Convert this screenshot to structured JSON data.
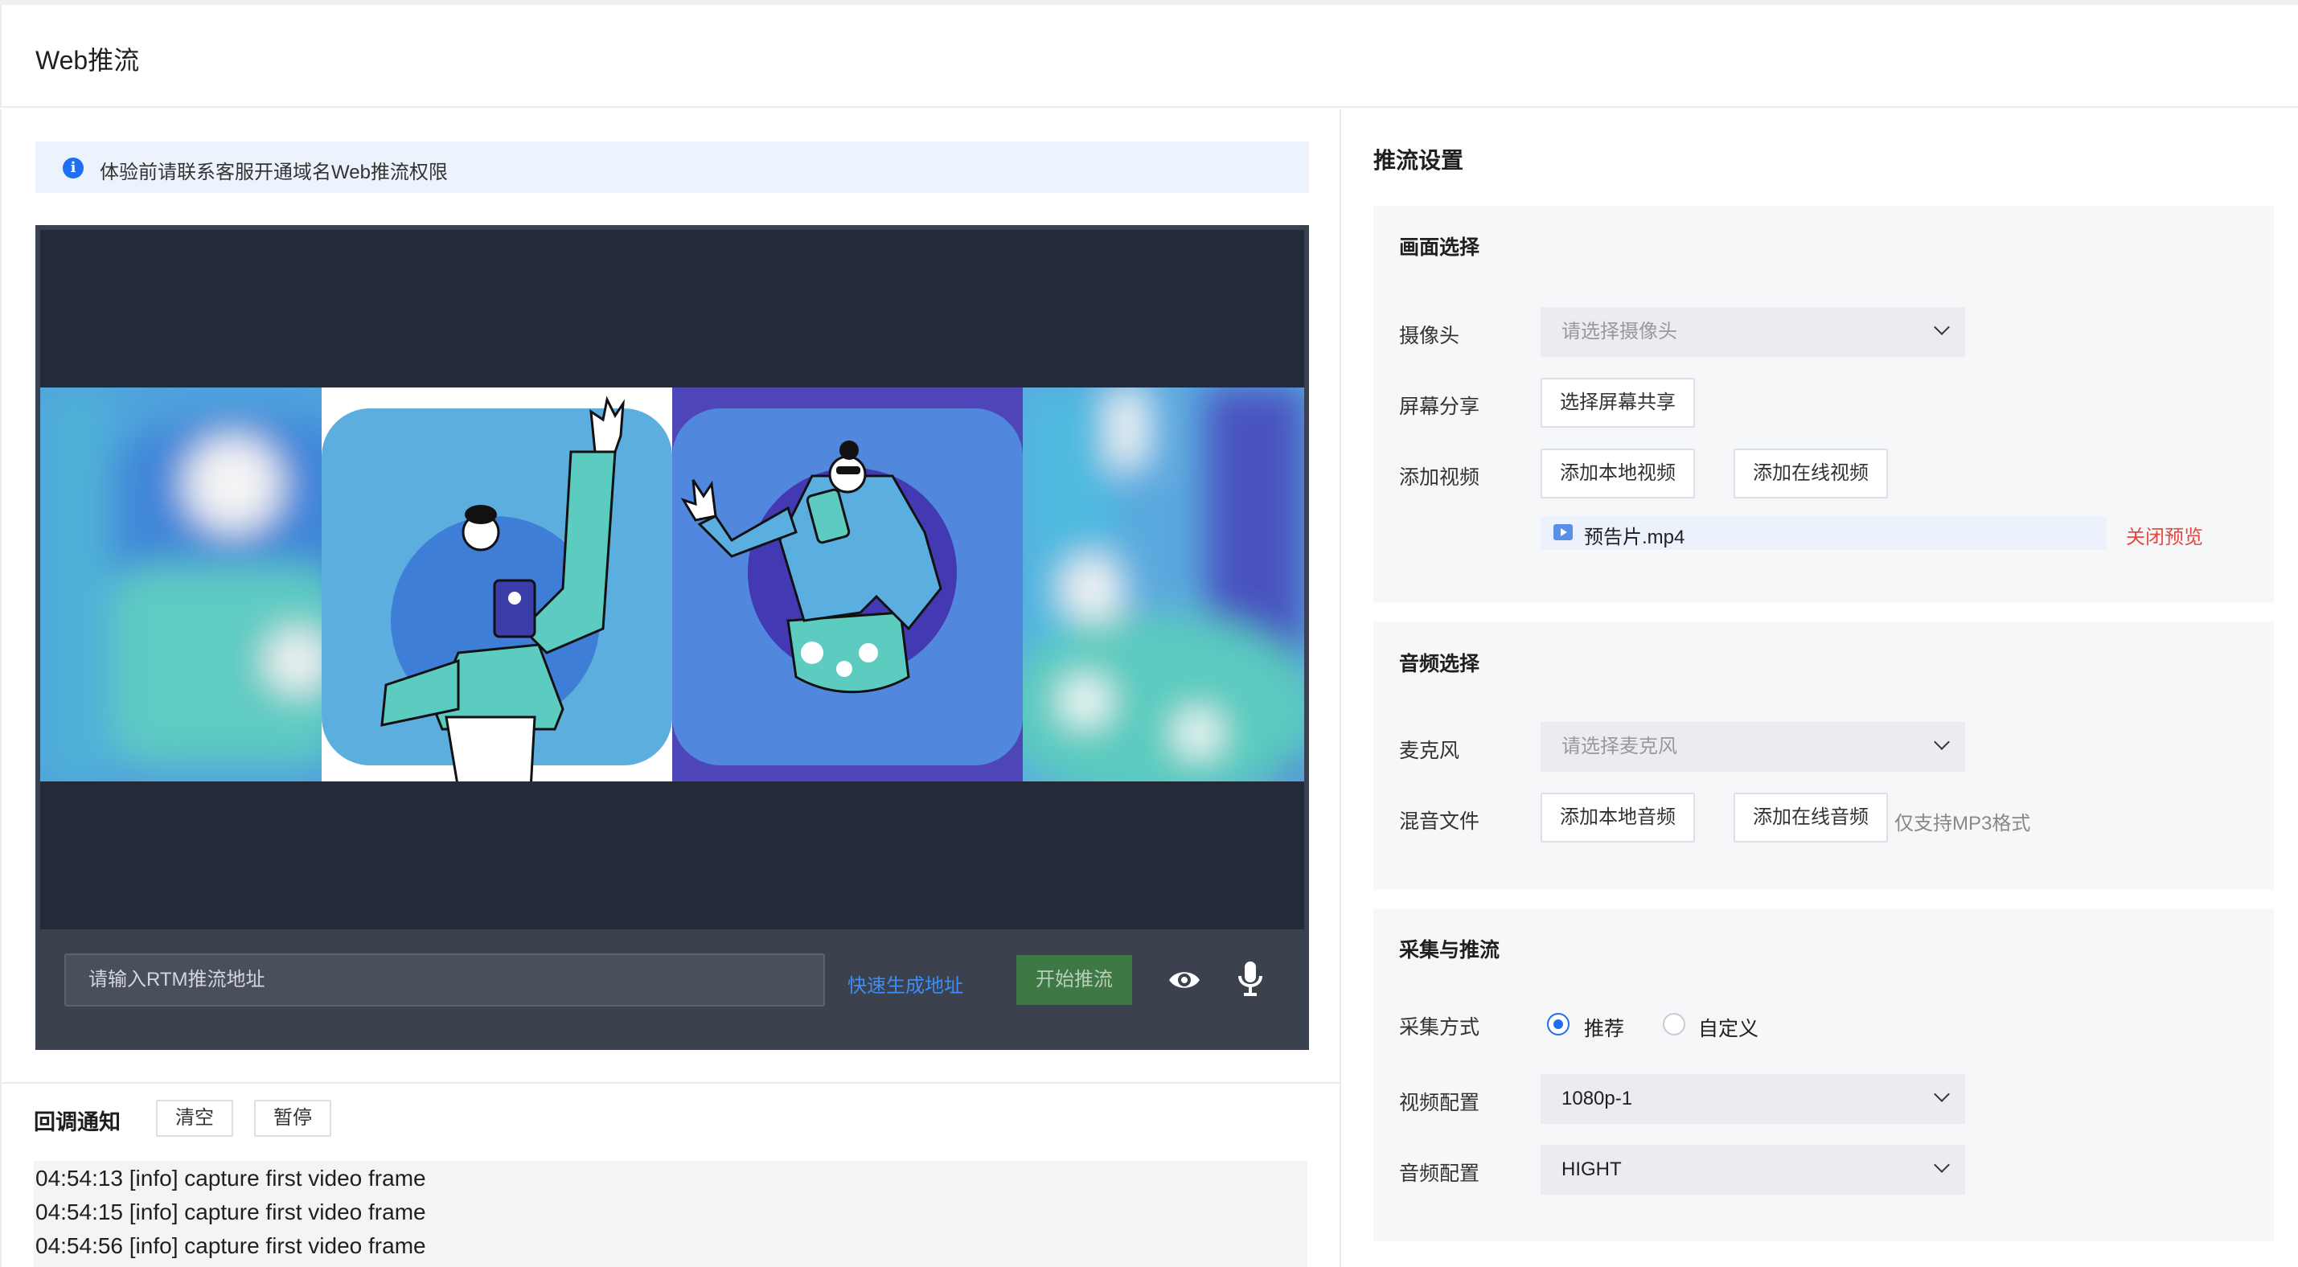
{
  "header": {
    "title": "Web推流"
  },
  "notice": {
    "text": "体验前请联系客服开通域名Web推流权限"
  },
  "player": {
    "rtmp_placeholder": "请输入RTM推流地址",
    "quick_generate": "快速生成地址",
    "start_button": "开始推流"
  },
  "callback": {
    "title": "回调通知",
    "clear": "清空",
    "pause": "暂停",
    "logs": [
      "04:54:13 [info] capture first video frame",
      "04:54:15 [info] capture first video frame",
      "04:54:56 [info] capture first video frame"
    ]
  },
  "settings": {
    "title": "推流设置",
    "picture": {
      "title": "画面选择",
      "camera_label": "摄像头",
      "camera_placeholder": "请选择摄像头",
      "screen_label": "屏幕分享",
      "screen_button": "选择屏幕共享",
      "video_label": "添加视频",
      "local_video": "添加本地视频",
      "online_video": "添加在线视频",
      "file_name": "预告片.mp4",
      "close_preview": "关闭预览"
    },
    "audio": {
      "title": "音频选择",
      "mic_label": "麦克风",
      "mic_placeholder": "请选择麦克风",
      "mix_label": "混音文件",
      "local_audio": "添加本地音频",
      "online_audio": "添加在线音频",
      "mp3_hint": "仅支持MP3格式"
    },
    "capture": {
      "title": "采集与推流",
      "mode_label": "采集方式",
      "mode_recommended": "推荐",
      "mode_custom": "自定义",
      "video_label": "视频配置",
      "video_value": "1080p-1",
      "audio_label": "音频配置",
      "audio_value": "HIGHT"
    }
  }
}
